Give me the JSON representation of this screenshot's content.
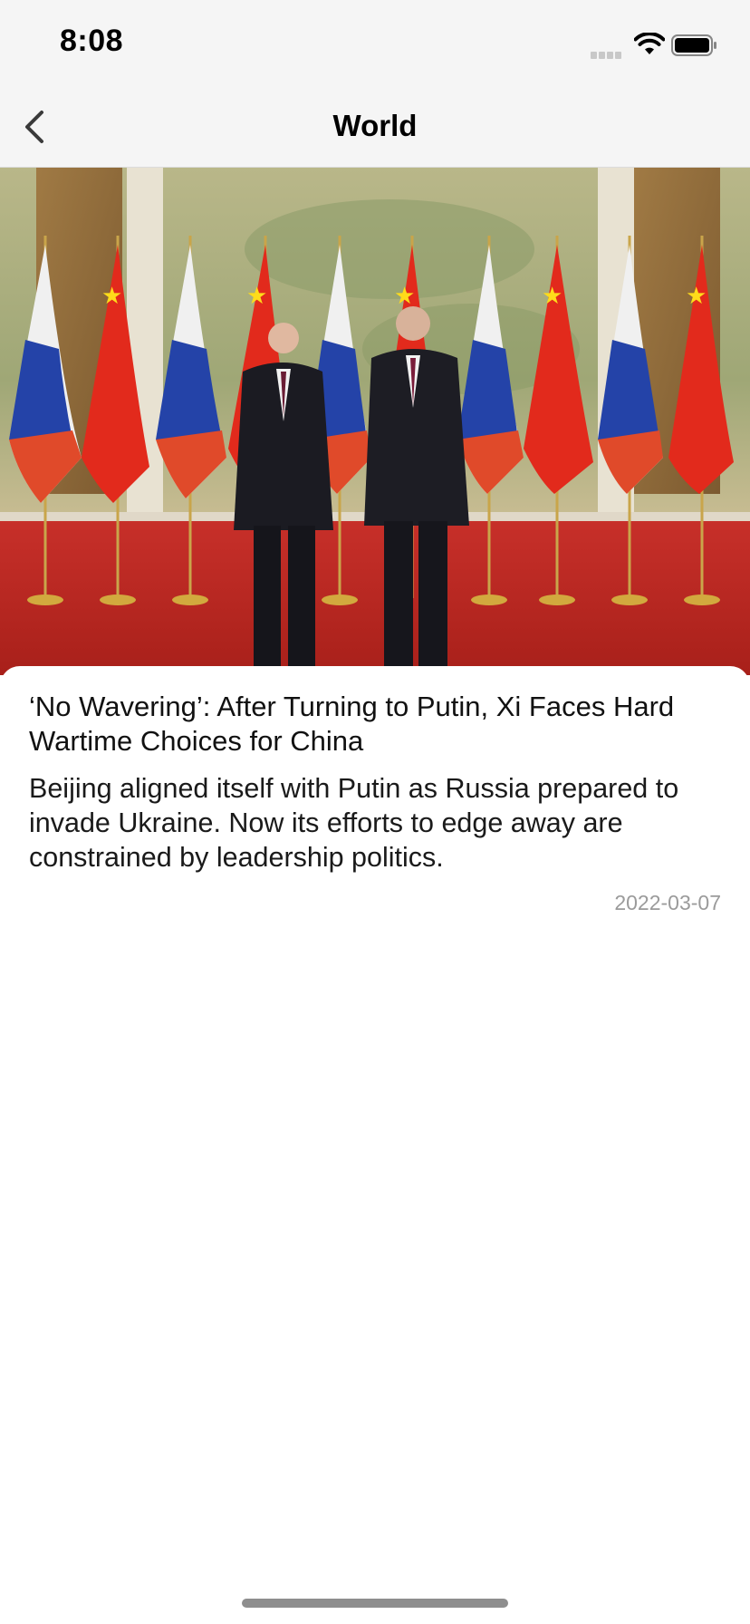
{
  "status_bar": {
    "time": "8:08",
    "icons": [
      "signal-icon",
      "wifi-icon",
      "battery-icon"
    ]
  },
  "nav": {
    "title": "World",
    "back_icon": "chevron-left-icon"
  },
  "article": {
    "image_description_icon": "news-photo",
    "title": "‘No Wavering’: After Turning to Putin, Xi Faces Hard Wartime Choices for China",
    "summary": "Beijing aligned itself with Putin as Russia prepared to invade Ukraine. Now its efforts to edge away are constrained by leadership politics.",
    "date": "2022-03-07"
  },
  "colors": {
    "bar_background": "#f5f5f5",
    "text_primary": "#111111",
    "date_gray": "#9b9b9b",
    "home_indicator": "#8e8e8e"
  }
}
